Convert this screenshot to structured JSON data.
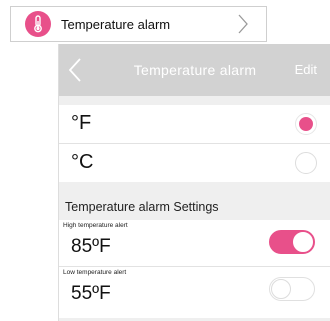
{
  "top_row": {
    "label": "Temperature alarm",
    "icon": "thermometer-icon",
    "chevron_icon": "chevron-right-icon"
  },
  "nav": {
    "back_icon": "back-chevron-icon",
    "title": "Temperature alarm",
    "edit_label": "Edit"
  },
  "units": [
    {
      "label": "°F",
      "selected": true
    },
    {
      "label": "°C",
      "selected": false
    }
  ],
  "settings": {
    "section_title": "Temperature alarm Settings",
    "high": {
      "caption": "High temperature alert",
      "value": "85ºF",
      "enabled": true
    },
    "low": {
      "caption": "Low temperature alert",
      "value": "55ºF",
      "enabled": false
    }
  },
  "colors": {
    "accent": "#e8508a",
    "nav_background": "#d2d2d2",
    "section_background": "#efefef"
  }
}
